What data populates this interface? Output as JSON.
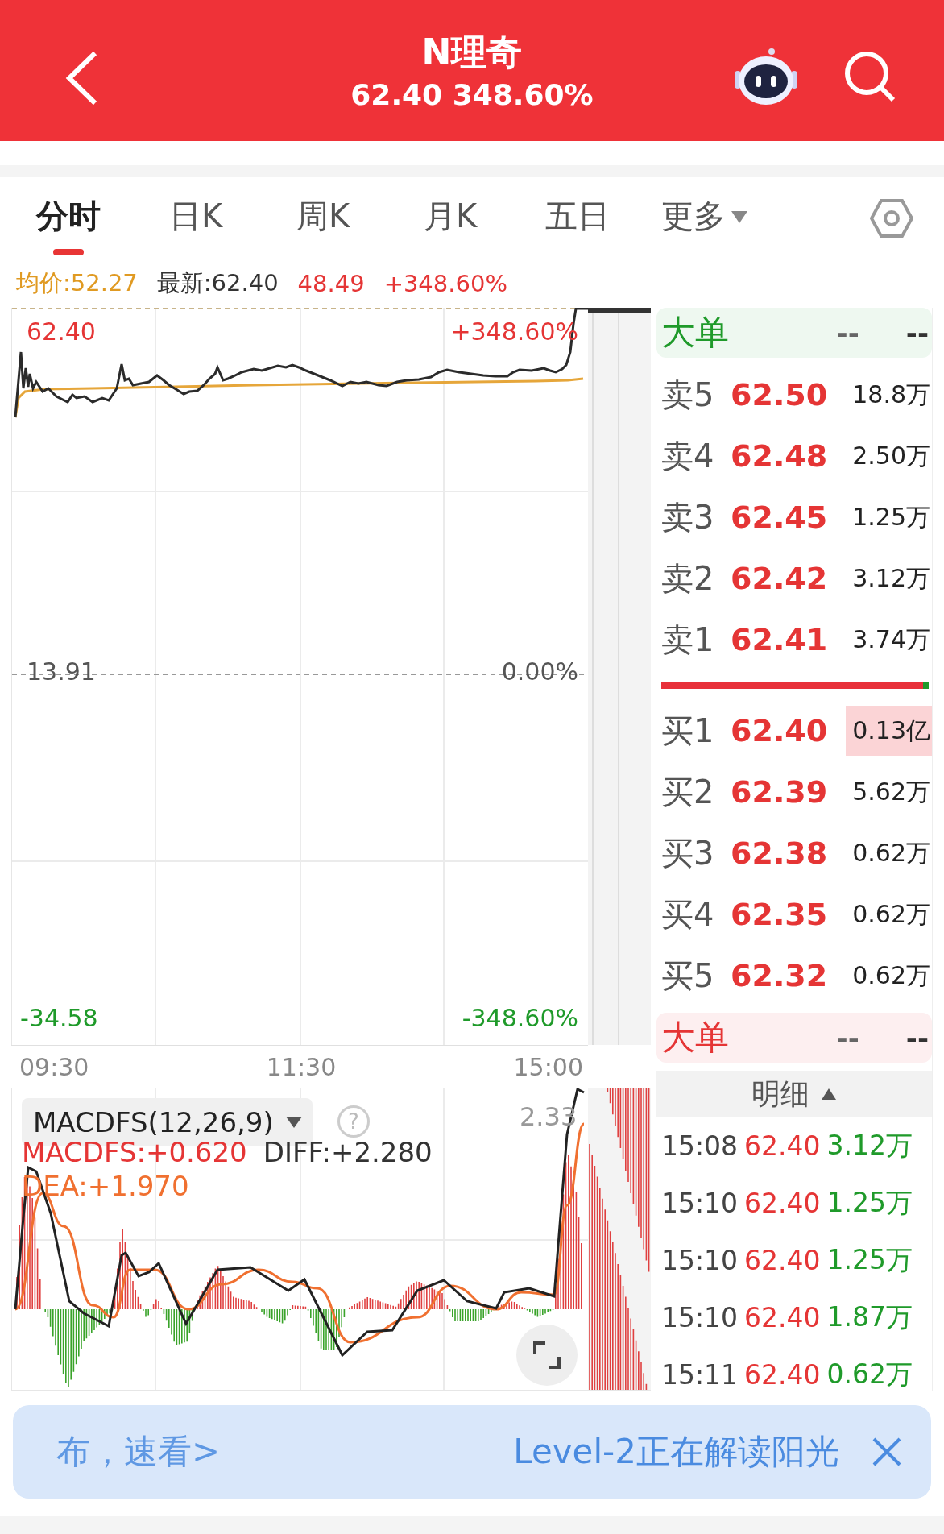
{
  "header": {
    "title": "N理奇",
    "subtitle": "62.40 348.60%"
  },
  "tabs": [
    {
      "label": "分时",
      "selected": true,
      "kind": "plain"
    },
    {
      "label": "日K",
      "selected": false,
      "kind": "plain"
    },
    {
      "label": "周K",
      "selected": false,
      "kind": "plain"
    },
    {
      "label": "月K",
      "selected": false,
      "kind": "plain"
    },
    {
      "label": "五日",
      "selected": false,
      "kind": "plain"
    },
    {
      "label": "更多",
      "selected": false,
      "kind": "dropdown"
    }
  ],
  "info_bar": [
    {
      "text": "均价:52.27",
      "kind": "average"
    },
    {
      "text": "最新:62.40",
      "kind": "latest"
    },
    {
      "text": "48.49",
      "kind": "up"
    },
    {
      "text": "+348.60%",
      "kind": "up"
    }
  ],
  "price_chart": {
    "left_labels": [
      {
        "text": "62.40",
        "kind": "up"
      },
      {
        "text": "13.91",
        "kind": "flat"
      },
      {
        "text": "-34.58",
        "kind": "down"
      }
    ],
    "right_labels": [
      {
        "text": "+348.60%",
        "kind": "up"
      },
      {
        "text": "0.00%",
        "kind": "flat"
      },
      {
        "text": "-348.60%",
        "kind": "down"
      }
    ]
  },
  "time_labels": [
    "09:30",
    "11:30",
    "15:00"
  ],
  "macd": {
    "selector": "MACDFS(12,26,9)",
    "help": "?",
    "max_label": "2.33",
    "values": [
      {
        "text": "MACDFS:+0.620",
        "kind": "macd"
      },
      {
        "text": "DIFF:+2.280",
        "kind": "diff"
      },
      {
        "text": "DEA:+1.970",
        "kind": "dea"
      }
    ]
  },
  "order_book": {
    "big_sell": {
      "label": "大单",
      "kind": "sell",
      "value_1": "--",
      "value_2": "--"
    },
    "asks": [
      {
        "label": "卖5",
        "price": "62.50",
        "volume": "18.8万",
        "highlighted": false
      },
      {
        "label": "卖4",
        "price": "62.48",
        "volume": "2.50万",
        "highlighted": false
      },
      {
        "label": "卖3",
        "price": "62.45",
        "volume": "1.25万",
        "highlighted": false
      },
      {
        "label": "卖2",
        "price": "62.42",
        "volume": "3.12万",
        "highlighted": false
      },
      {
        "label": "卖1",
        "price": "62.41",
        "volume": "3.74万",
        "highlighted": false
      }
    ],
    "ratio_bar": {
      "level": 0.98
    },
    "bids": [
      {
        "label": "买1",
        "price": "62.40",
        "volume": "0.13亿",
        "highlighted": true
      },
      {
        "label": "买2",
        "price": "62.39",
        "volume": "5.62万",
        "highlighted": false
      },
      {
        "label": "买3",
        "price": "62.38",
        "volume": "0.62万",
        "highlighted": false
      },
      {
        "label": "买4",
        "price": "62.35",
        "volume": "0.62万",
        "highlighted": false
      },
      {
        "label": "买5",
        "price": "62.32",
        "volume": "0.62万",
        "highlighted": false
      }
    ],
    "big_buy": {
      "label": "大单",
      "kind": "buy",
      "value_1": "--",
      "value_2": "--"
    }
  },
  "trade_details": {
    "title": "明细",
    "rows": [
      {
        "time": "15:08",
        "price": "62.40",
        "volume": "3.12万"
      },
      {
        "time": "15:10",
        "price": "62.40",
        "volume": "1.25万"
      },
      {
        "time": "15:10",
        "price": "62.40",
        "volume": "1.25万"
      },
      {
        "time": "15:10",
        "price": "62.40",
        "volume": "1.87万"
      },
      {
        "time": "15:11",
        "price": "62.40",
        "volume": "0.62万"
      }
    ]
  },
  "banner": {
    "text_left": "布，速看>",
    "text_right": "Level-2正在解读阳光"
  }
}
